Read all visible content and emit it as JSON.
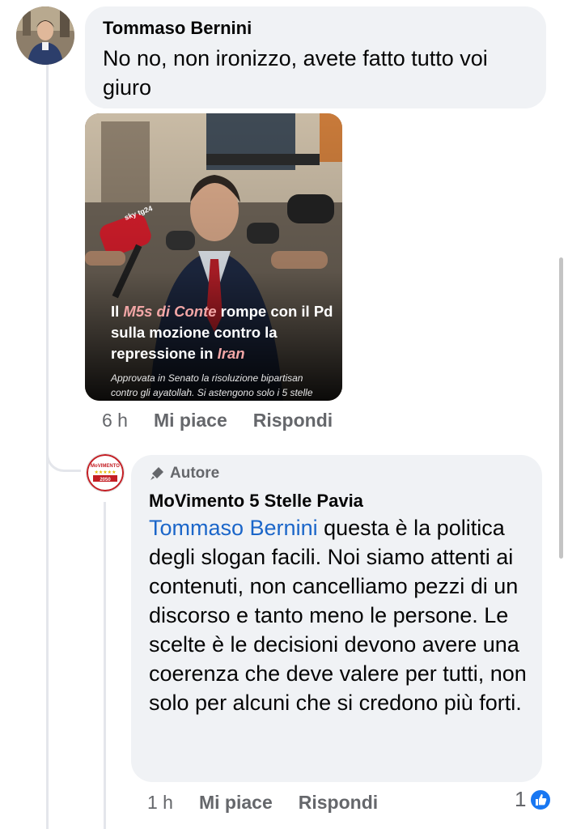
{
  "comment1": {
    "author": "Tommaso Bernini",
    "text": "No no, non ironizzo, avete fatto tutto voi giuro",
    "image": {
      "headline_parts": [
        "Il ",
        "M5s di Conte",
        " rompe con il Pd sulla mozione contro la repressione in ",
        "Iran"
      ],
      "subheadline": "Approvata in Senato la risoluzione bipartisan contro gli ayatollah. Si astengono solo i 5 stelle",
      "logo_text": "sky tg24"
    },
    "time": "6 h",
    "like_label": "Mi piace",
    "reply_label": "Rispondi"
  },
  "comment2": {
    "badge": "Autore",
    "author": "MoVimento 5 Stelle Pavia",
    "mention": "Tommaso Bernini",
    "text": " questa è la politica degli slogan facili. Noi siamo attenti ai contenuti, non cancelliamo pezzi di un discorso e tanto meno le persone. Le scelte è le decisioni devono avere una coerenza che deve valere per tutti, non solo per alcuni che si credono più forti.",
    "logo_text": "MoVimento 2050",
    "time": "1 h",
    "like_label": "Mi piace",
    "reply_label": "Rispondi",
    "reaction_count": "1"
  },
  "colors": {
    "bubble": "#f0f2f5",
    "mention": "#1b66c9",
    "like_blue": "#1877f2",
    "meta": "#65676b"
  }
}
